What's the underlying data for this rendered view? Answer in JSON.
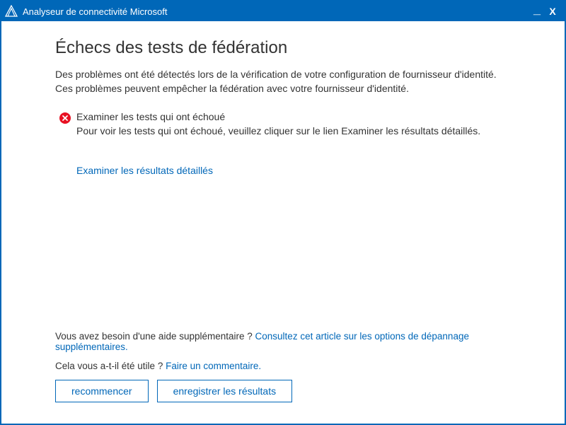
{
  "titlebar": {
    "title": "Analyseur de connectivité Microsoft"
  },
  "page": {
    "heading": "Échecs des tests de fédération",
    "description_line1": "Des problèmes ont été détectés lors de la vérification de votre configuration de fournisseur d'identité.",
    "description_line2": "Ces problèmes peuvent empêcher la fédération avec votre fournisseur d'identité."
  },
  "issue": {
    "title": "Examiner les tests qui ont échoué",
    "subtitle": "Pour voir les tests qui ont échoué, veuillez cliquer sur le lien Examiner les résultats détaillés."
  },
  "links": {
    "detailed_results": "Examiner les résultats détaillés"
  },
  "help": {
    "prompt": "Vous avez besoin d'une aide supplémentaire ? ",
    "link": "Consultez cet article sur les options de dépannage supplémentaires."
  },
  "feedback": {
    "prompt": "Cela vous a-t-il été utile ? ",
    "link": "Faire un commentaire."
  },
  "buttons": {
    "restart": "recommencer",
    "save": "enregistrer les résultats"
  }
}
